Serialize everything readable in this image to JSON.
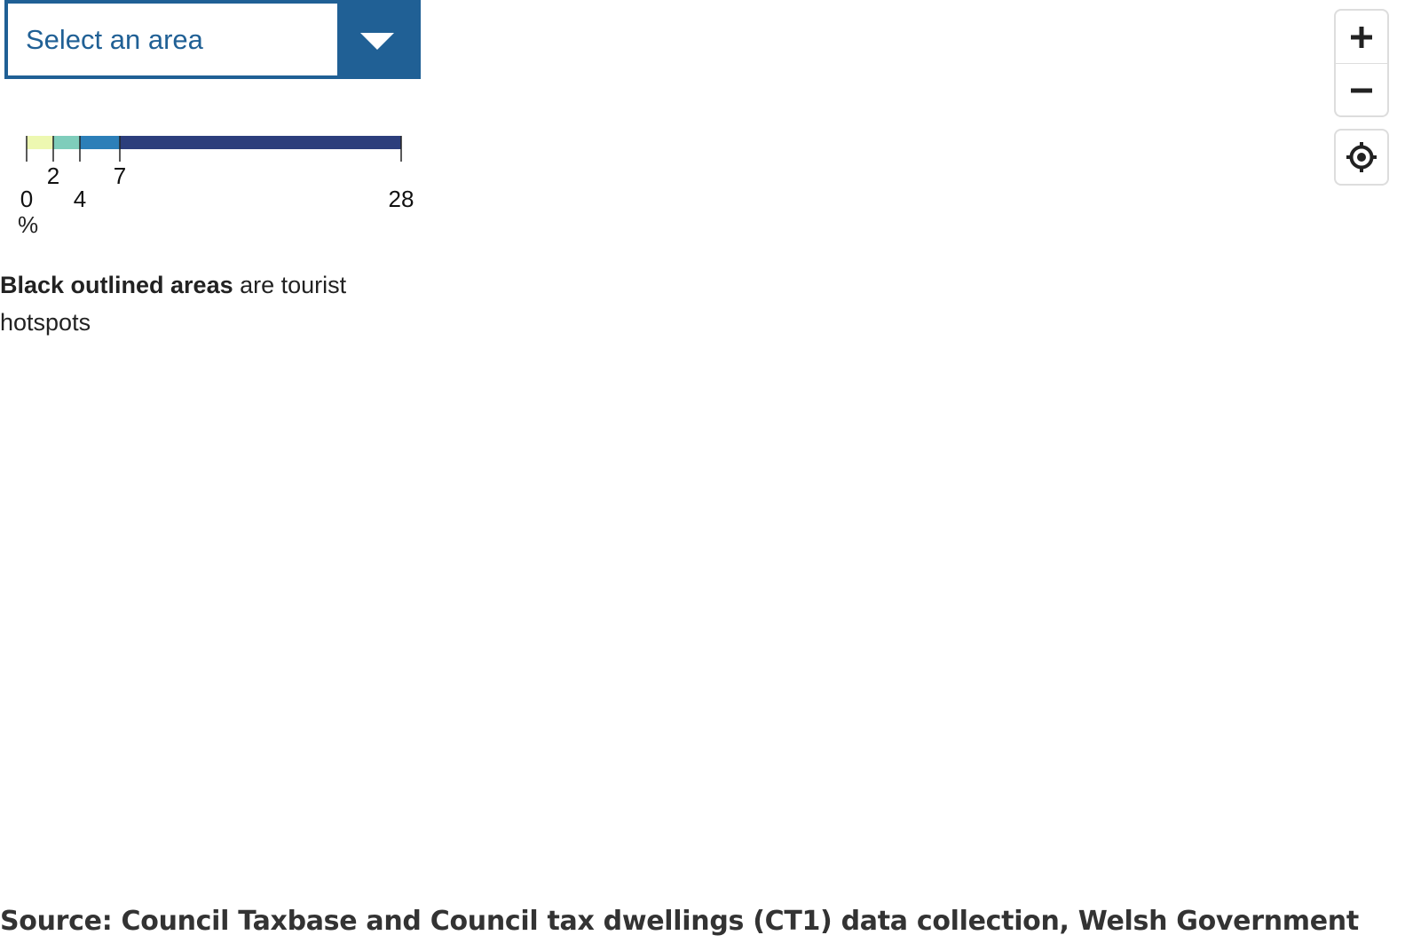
{
  "area_select": {
    "placeholder": "Select an area",
    "toggle_icon": "chevron-down-icon",
    "color": "#206095"
  },
  "legend": {
    "unit": "%",
    "breaks": [
      0,
      2,
      4,
      7,
      28
    ],
    "break_labels": [
      "0",
      "2",
      "4",
      "7",
      "28"
    ],
    "colors": [
      "#edf8b1",
      "#7fcdbb",
      "#2c7fb8",
      "#2c3e7c"
    ]
  },
  "note": {
    "bold": "Black outlined areas",
    "rest": " are tourist hotspots"
  },
  "map_controls": {
    "zoom_in_icon": "plus-icon",
    "zoom_out_icon": "minus-icon",
    "locate_icon": "locate-icon"
  },
  "source": {
    "text": "Source: Council Taxbase and Council tax dwellings (CT1) data collection, Welsh Government"
  }
}
